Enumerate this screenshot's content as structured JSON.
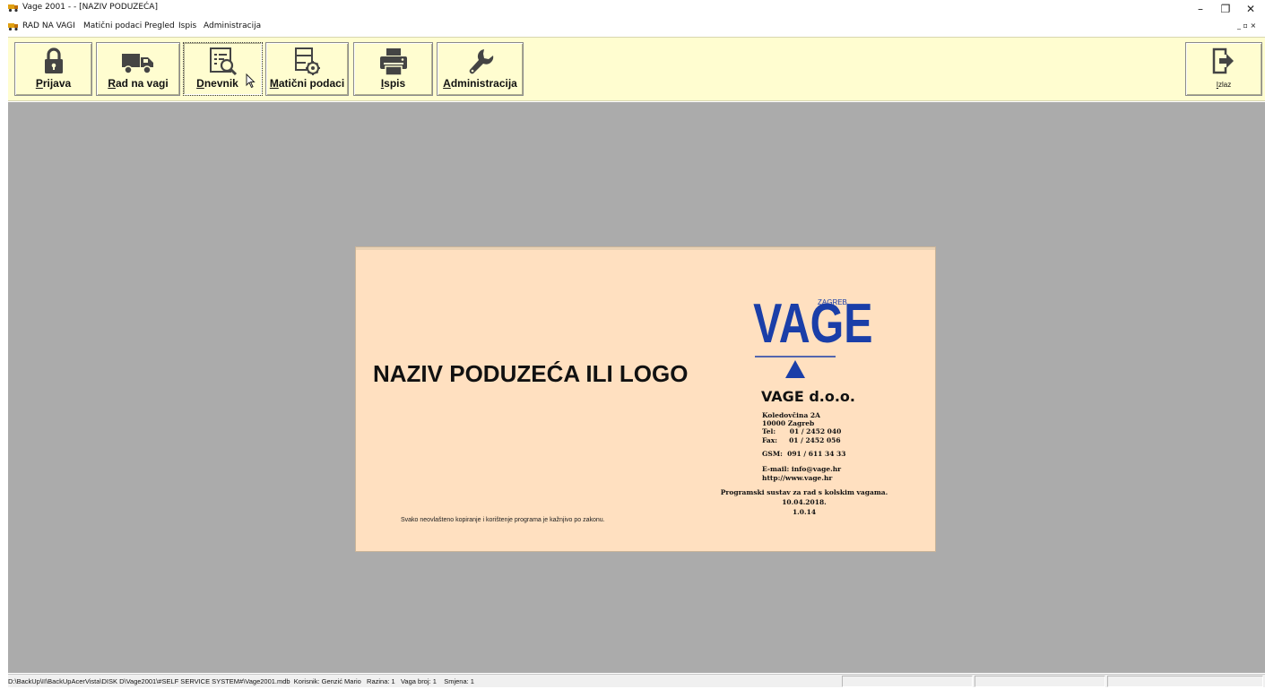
{
  "window": {
    "title": "Vage 2001 - - [NAZIV PODUZEĆA]",
    "minimize": "–",
    "restore": "❐",
    "close": "✕"
  },
  "menu": {
    "items": [
      "RAD NA VAGI",
      "Matični podaci",
      "Pregled",
      "Ispis",
      "Administracija"
    ],
    "mdi_controls": "_ ▫ ×"
  },
  "toolbar": {
    "buttons": [
      {
        "label": "Prijava",
        "icon": "lock-icon"
      },
      {
        "label": "Rad na vagi",
        "icon": "truck-icon"
      },
      {
        "label": "Dnevnik",
        "icon": "log-search-icon"
      },
      {
        "label": "Matični podaci",
        "icon": "settings-doc-icon"
      },
      {
        "label": "Ispis",
        "icon": "printer-icon"
      },
      {
        "label": "Administracija",
        "icon": "wrench-icon"
      }
    ],
    "exit": {
      "label": "Izlaz",
      "icon": "exit-icon"
    }
  },
  "splash": {
    "company_placeholder": "NAZIV PODUZEĆA ILI LOGO",
    "copyright": "Svako neovlašteno kopiranje i korištenje programa je kažnjivo po zakonu.",
    "logo_text": "VAGE",
    "logo_subtext": "ZAGREB",
    "vendor": "VAGE d.o.o.",
    "address_line1": "Koledovčina 2A",
    "address_line2": "10000 Zagreb",
    "tel": "Tel:      01 / 2452 040",
    "fax": "Fax:     01 / 2452 056",
    "gsm": "GSM:  091 / 611 34 33",
    "email": "E-mail: info@vage.hr",
    "web": "http://www.vage.hr",
    "product_desc": "Programski sustav za rad s kolskim vagama.",
    "date": "10.04.2018.",
    "version": "1.0.14"
  },
  "status": {
    "main": "D:\\BackUp\\II\\BackUpAcerVista\\DISK D\\Vage2001\\#SELF SERVICE SYSTEM#\\Vage2001.mdb  Korisnik: Genzić Mario   Razina: 1   Vaga broj: 1    Smjena: 1"
  },
  "colors": {
    "toolbar_bg": "#fffdd0",
    "workspace_bg": "#ababab",
    "splash_bg": "#ffe0c0",
    "logo_blue": "#1a3ea8"
  }
}
